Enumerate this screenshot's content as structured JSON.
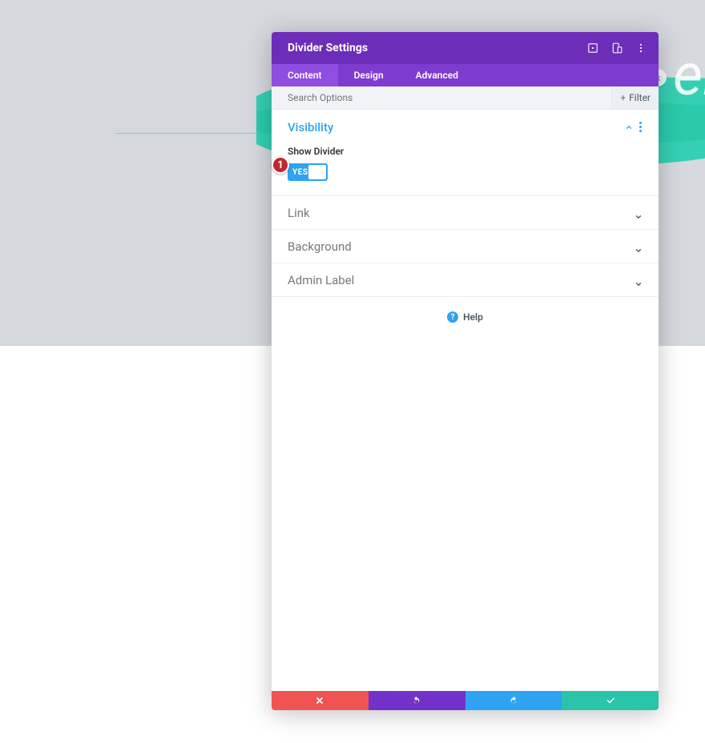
{
  "header": {
    "title": "Divider Settings"
  },
  "tabs": {
    "content": "Content",
    "design": "Design",
    "advanced": "Advanced"
  },
  "search": {
    "placeholder": "Search Options",
    "filter_label": "Filter"
  },
  "visibility": {
    "title": "Visibility",
    "show_divider_label": "Show Divider",
    "toggle_label": "YES"
  },
  "sections": {
    "link": "Link",
    "background": "Background",
    "admin_label": "Admin Label"
  },
  "help_label": "Help",
  "callout_number": "1"
}
